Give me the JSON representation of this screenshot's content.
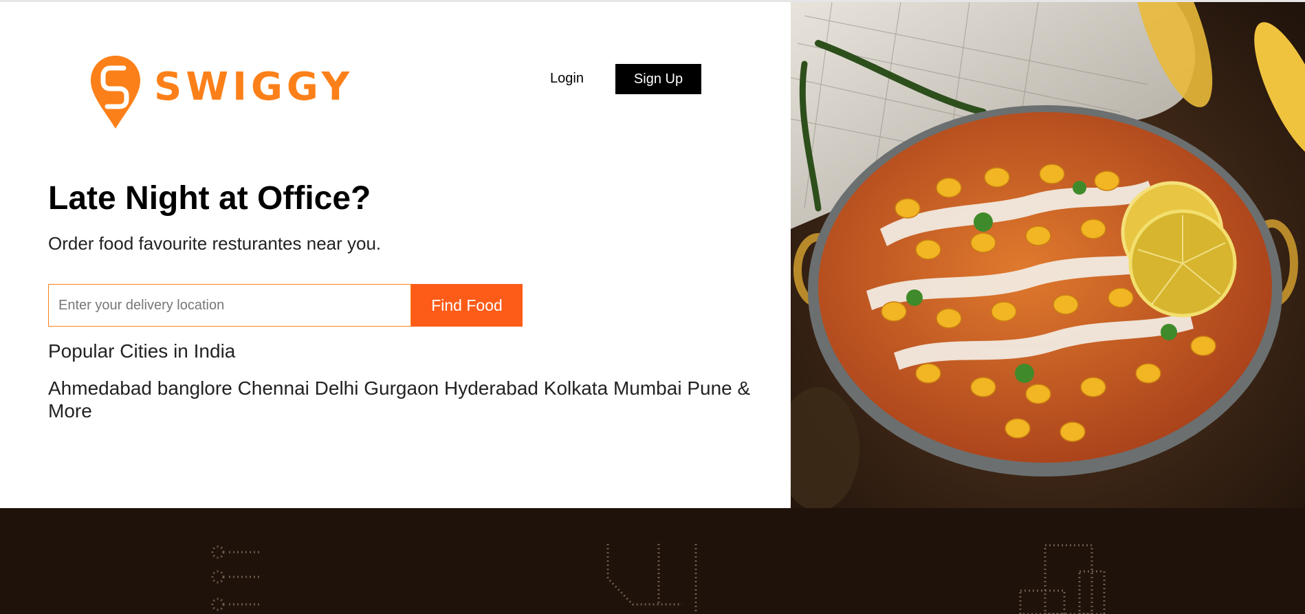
{
  "brand": {
    "name": "SWIGGY",
    "color": "#fc8019",
    "logo_icon": "swiggy-pin-icon"
  },
  "nav": {
    "login_label": "Login",
    "signup_label": "Sign Up"
  },
  "hero": {
    "headline": "Late Night at Office?",
    "subline": "Order food favourite resturantes near you.",
    "search": {
      "placeholder": "Enter your delivery location",
      "value": "",
      "button_label": "Find Food",
      "button_color": "#fc5b18"
    },
    "image_alt": "food-bowl-image"
  },
  "popular": {
    "title": "Popular Cities in India",
    "cities": [
      "Ahmedabad",
      "banglore",
      "Chennai",
      "Delhi",
      "Gurgaon",
      "Hyderabad",
      "Kolkata",
      "Mumbai",
      "Pune"
    ],
    "more_label": "& More"
  },
  "footer_band": {
    "background": "#1f120a",
    "icons": [
      "checklist-icon",
      "food-bag-icon",
      "buildings-icon"
    ]
  }
}
